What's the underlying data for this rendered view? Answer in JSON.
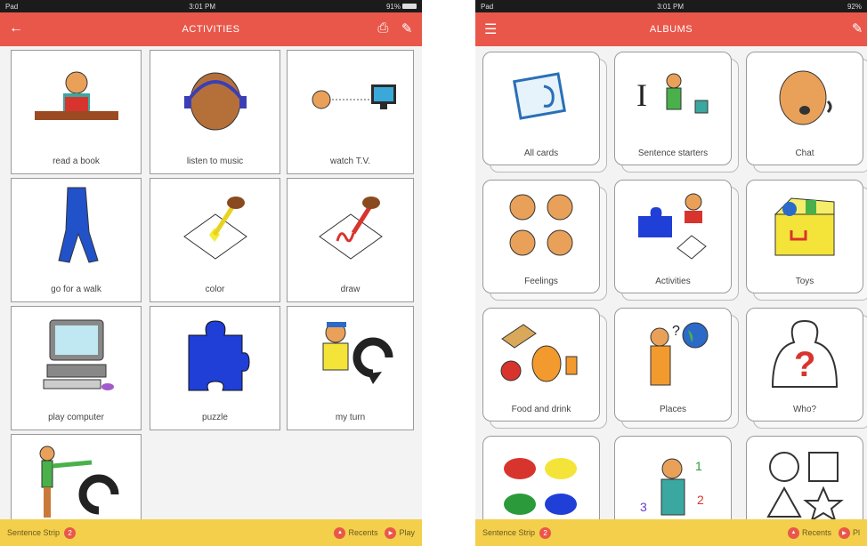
{
  "left_screen": {
    "status": {
      "carrier": "Pad",
      "time": "3:01 PM",
      "battery": "91%"
    },
    "header": {
      "title": "ACTIVITIES",
      "back_icon": "back-arrow-icon",
      "print_icon": "printer-icon",
      "edit_icon": "pencil-icon"
    },
    "cards": [
      {
        "label": "read a book",
        "icon": "read-book-icon"
      },
      {
        "label": "listen to music",
        "icon": "listen-music-icon"
      },
      {
        "label": "watch T.V.",
        "icon": "watch-tv-icon"
      },
      {
        "label": "go for a walk",
        "icon": "walk-icon"
      },
      {
        "label": "color",
        "icon": "color-icon"
      },
      {
        "label": "draw",
        "icon": "draw-icon"
      },
      {
        "label": "play computer",
        "icon": "computer-icon"
      },
      {
        "label": "puzzle",
        "icon": "puzzle-icon"
      },
      {
        "label": "my turn",
        "icon": "my-turn-icon"
      },
      {
        "label": "",
        "icon": "your-turn-icon"
      }
    ],
    "bottom": {
      "sentence_strip": "Sentence Strip",
      "count": "2",
      "recents": "Recents",
      "play": "Play"
    }
  },
  "right_screen": {
    "status": {
      "carrier": "Pad",
      "time": "3:01 PM",
      "battery": "92%"
    },
    "header": {
      "title": "ALBUMS",
      "menu_icon": "menu-icon",
      "edit_icon": "pencil-icon"
    },
    "albums": [
      {
        "label": "All cards",
        "icon": "all-cards-icon"
      },
      {
        "label": "Sentence starters",
        "icon": "sentence-starters-icon"
      },
      {
        "label": "Chat",
        "icon": "chat-icon"
      },
      {
        "label": "Feelings",
        "icon": "feelings-icon"
      },
      {
        "label": "Activities",
        "icon": "activities-icon"
      },
      {
        "label": "Toys",
        "icon": "toys-icon"
      },
      {
        "label": "Food and drink",
        "icon": "food-drink-icon"
      },
      {
        "label": "Places",
        "icon": "places-icon"
      },
      {
        "label": "Who?",
        "icon": "who-icon"
      },
      {
        "label": "",
        "icon": "colors-icon"
      },
      {
        "label": "",
        "icon": "numbers-icon"
      },
      {
        "label": "",
        "icon": "shapes-icon"
      }
    ],
    "bottom": {
      "sentence_strip": "Sentence Strip",
      "count": "2",
      "recents": "Recents",
      "play": "Pl"
    }
  },
  "colors": {
    "header": "#e9574a",
    "bottom_bar": "#f3cf4c",
    "accent": "#e9574a"
  }
}
